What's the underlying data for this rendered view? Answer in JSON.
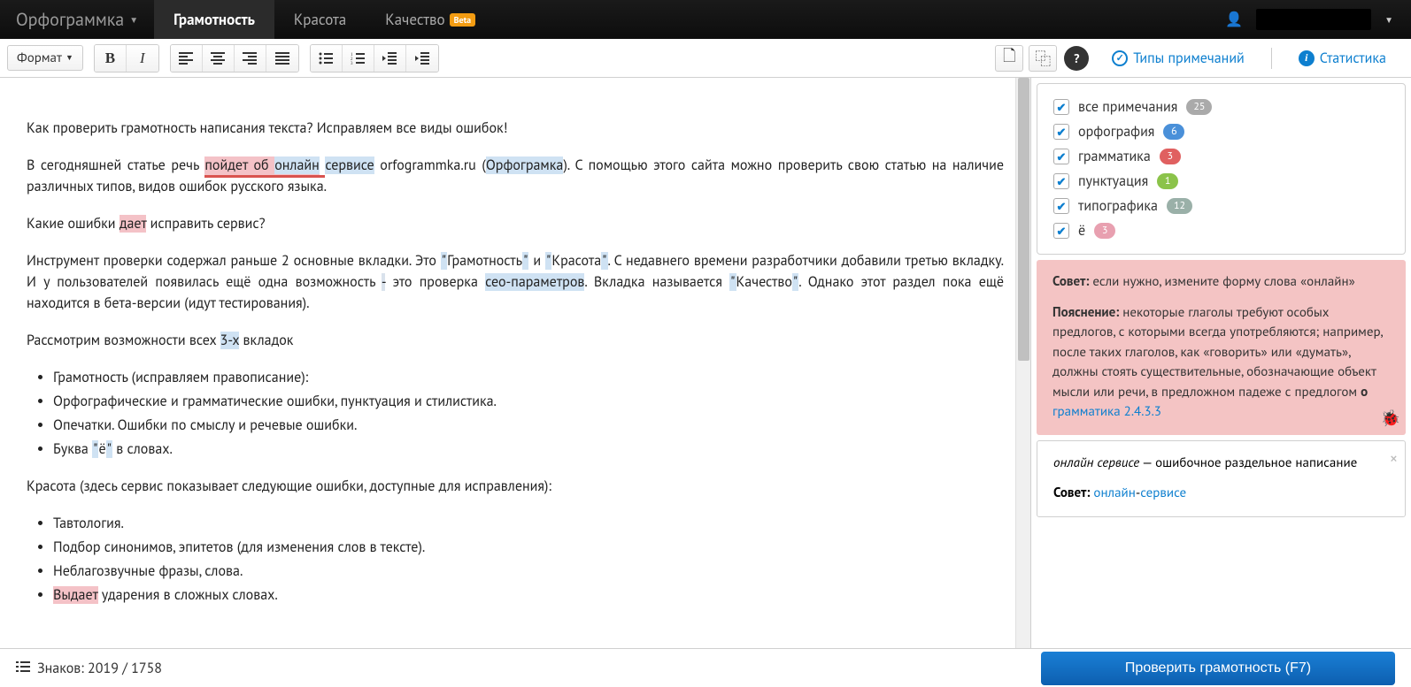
{
  "brand": "Орфограммка",
  "tabs": [
    "Грамотность",
    "Красота",
    "Качество"
  ],
  "active_tab": 0,
  "beta_badge": "Beta",
  "format_btn": "Формат",
  "side_links": {
    "types": "Типы примечаний",
    "stats": "Статистика"
  },
  "filters": [
    {
      "label": "все примечания",
      "count": 25,
      "pill": "pill-gray"
    },
    {
      "label": "орфография",
      "count": 6,
      "pill": "pill-blue"
    },
    {
      "label": "грамматика",
      "count": 3,
      "pill": "pill-red"
    },
    {
      "label": "пунктуация",
      "count": 1,
      "pill": "pill-green"
    },
    {
      "label": "типографика",
      "count": 12,
      "pill": "pill-teal"
    },
    {
      "label": "ё",
      "count": 3,
      "pill": "pill-pink"
    }
  ],
  "editor": {
    "p1": "Как проверить грамотность написания текста? Исправляем все виды ошибок!",
    "p2a": "В сегодняшней статье речь ",
    "p2_hl1": "пойдет об ",
    "p2_hl2": "онлайн",
    "p2_sp": " ",
    "p2_hl3": "сервисе",
    "p2b": " orfogrammka.ru (",
    "p2_hl4": "Орфограмка",
    "p2c": "). С помощью этого сайта можно проверить свою статью на наличие различных типов, видов ошибок русского языка.",
    "p3a": "Какие ошибки ",
    "p3_hl1": "дает",
    "p3b": " исправить сервис?",
    "p4a": "Инструмент проверки содержал раньше 2 основные вкладки. Это ",
    "p4_q1": "\"",
    "p4_w1": "Грамотность",
    "p4_q2": "\"",
    "p4b": " и ",
    "p4_q3": "\"",
    "p4_w2": "Красота",
    "p4_q4": "\"",
    "p4c": ". С недавнего времени разработчики добавили третью вкладку. И у пользователей появилась ещё одна возможность ",
    "p4_dash": "-",
    "p4d": " это проверка ",
    "p4_hl1": "сео-параметров",
    "p4e": ". Вкладка называется ",
    "p4_q5": "\"",
    "p4_w3": "Качество",
    "p4_q6": "\"",
    "p4f": ". Однако этот раздел пока ещё находится в бета-версии (идут тестирования).",
    "p5a": "Рассмотрим возможности всех ",
    "p5_hl1": "3-х",
    "p5b": " вкладок",
    "list1": [
      "Грамотность (исправляем правописание):",
      "Орфографические и грамматические ошибки, пунктуация и стилистика.",
      "Опечатки. Ошибки по смыслу и речевые ошибки."
    ],
    "list1_4a": "Буква ",
    "list1_4q1": "\"",
    "list1_4w": "ё",
    "list1_4q2": "\"",
    "list1_4b": " в словах.",
    "p6": "Красота (здесь сервис показывает следующие ошибки, доступные для исправления):",
    "list2": [
      "Тавтология.",
      "Подбор синонимов, эпитетов (для изменения слов в тексте).",
      "Неблагозвучные фразы, слова."
    ],
    "list2_4_hl": "Выдает",
    "list2_4b": " ударения в сложных словах."
  },
  "note1": {
    "tip_label": "Совет:",
    "tip_text": " если нужно, измените форму слова «онлайн»",
    "expl_label": "Пояснение:",
    "expl_text": " некоторые глаголы требуют особых предлогов, с которыми всегда употребляются; например, после таких глаголов, как «говорить» или «думать», должны стоять существительные, обозначающие объект мысли или речи, в предложном падеже с предлогом ",
    "expl_bold": "о",
    "rule_link": "грамматика 2.4.3.3"
  },
  "note2": {
    "term": "онлайн сервисе",
    "dash": " — ",
    "desc": "ошибочное раздельное написание",
    "tip_label": "Совет:",
    "sugg1": "онлайн",
    "sugg_dash": "-",
    "sugg2": "сервисе"
  },
  "footer": {
    "chars_label": "Знаков: ",
    "chars_value": "2019 / 1758",
    "check_btn": "Проверить грамотность (F7)"
  }
}
